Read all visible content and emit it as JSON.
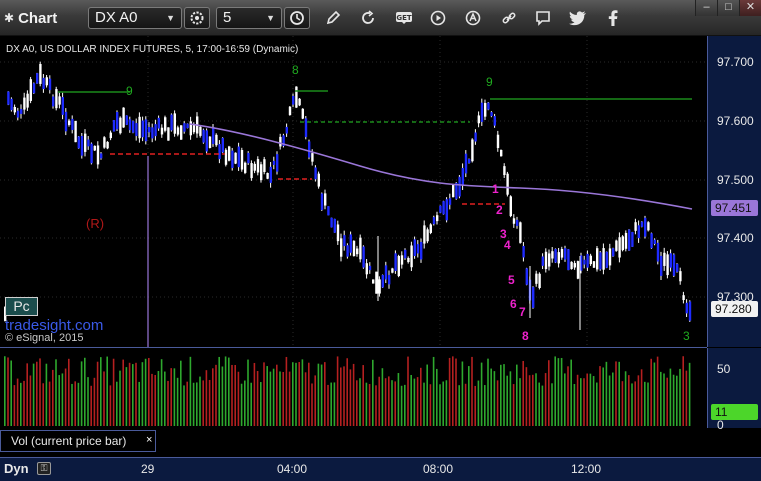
{
  "toolbar": {
    "app_title": "Chart",
    "symbol_value": "DX A0",
    "interval_value": "5",
    "icons": [
      "settings-icon",
      "clock-icon",
      "pencil-icon",
      "refresh-icon",
      "get-icon",
      "play-icon",
      "alert-icon",
      "link-icon",
      "comment-icon",
      "twitter-icon",
      "facebook-icon"
    ]
  },
  "chart": {
    "title": "DX A0, US DOLLAR INDEX FUTURES, 5, 17:00-16:59 (Dynamic)",
    "price_ticks": [
      "97.700",
      "97.600",
      "97.500",
      "97.400",
      "97.300"
    ],
    "current_price": "97.280",
    "ma_price": "97.451",
    "volume_ticks": [
      "50",
      "0"
    ],
    "current_volume": "11",
    "time_ticks": [
      "29",
      "04:00",
      "08:00",
      "12:00"
    ],
    "dyn_label": "Dyn",
    "resistance_marker": "(R)",
    "pc_badge": "Pc",
    "watermark": "tradesight.com",
    "copyright": "© eSignal, 2015",
    "volume_label": "Vol (current price bar)",
    "close_symbol": "×",
    "sell_setup_digits": [
      "1",
      "2",
      "3",
      "4",
      "5",
      "6",
      "7",
      "8"
    ],
    "green_setup_top": [
      "9",
      "8",
      "9"
    ],
    "green_last": "3",
    "colors": {
      "candle": "#1e2bff",
      "ma": "#9a76d8",
      "setup_green": "#1faa1f",
      "setup_red": "#e02020",
      "count_magenta": "#ee22cc",
      "vol_red": "#b52020",
      "vol_green": "#2ea82e",
      "panel_bg": "#0b1a3f"
    }
  }
}
